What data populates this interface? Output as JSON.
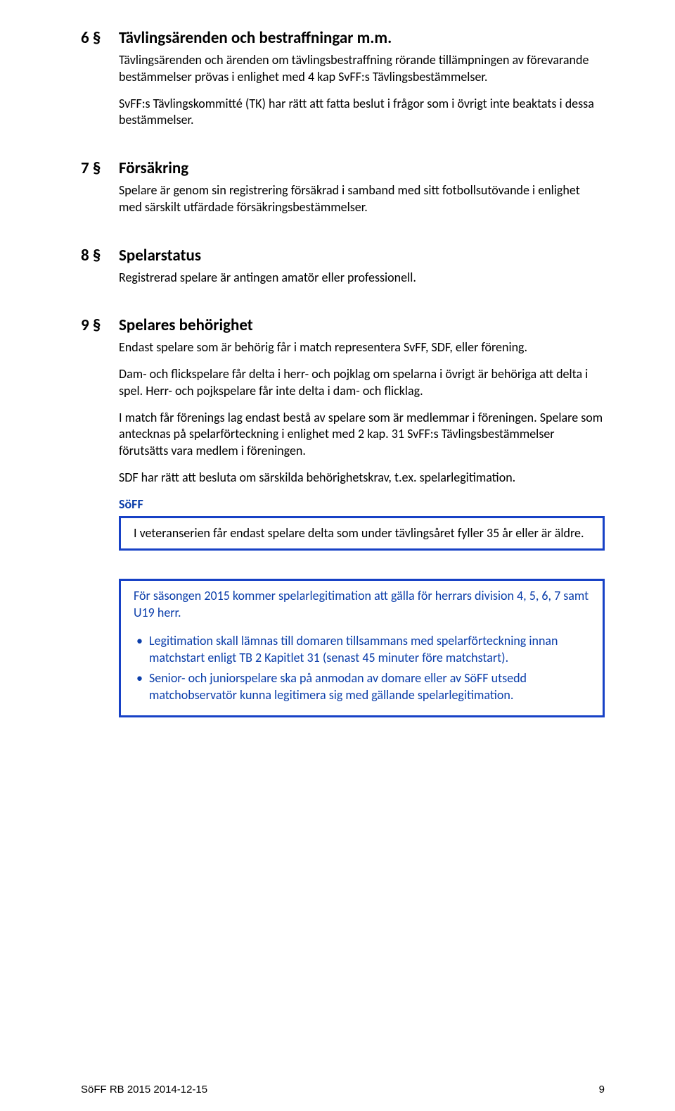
{
  "sections": {
    "s6": {
      "num": "6 §",
      "title": "Tävlingsärenden och bestraffningar m.m.",
      "paras": [
        "Tävlingsärenden och ärenden om tävlingsbestraffning rörande tillämpningen av förevarande bestämmelser prövas i enlighet med 4 kap SvFF:s Tävlingsbestämmelser.",
        "SvFF:s Tävlingskommitté (TK) har rätt att fatta beslut i frågor som i övrigt inte beaktats i dessa bestämmelser."
      ]
    },
    "s7": {
      "num": "7 §",
      "title": "Försäkring",
      "paras": [
        "Spelare är genom sin registrering försäkrad i samband med sitt fotbollsutövande i enlighet med särskilt utfärdade försäkringsbestämmelser."
      ]
    },
    "s8": {
      "num": "8 §",
      "title": "Spelarstatus",
      "paras": [
        "Registrerad spelare är antingen amatör eller professionell."
      ]
    },
    "s9": {
      "num": "9 §",
      "title": "Spelares behörighet",
      "paras": [
        "Endast spelare som är behörig får i match representera SvFF, SDF, eller förening.",
        "Dam- och flickspelare får delta i herr- och pojklag om spelarna i övrigt är behöriga att delta i spel. Herr- och pojkspelare får inte delta i dam- och flicklag.",
        "I match får förenings lag endast bestå av spelare som är medlemmar i föreningen. Spelare som antecknas på spelarförteckning i enlighet med 2 kap. 31 SvFF:s Tävlingsbestämmelser förutsätts vara medlem i föreningen.",
        "SDF har rätt att besluta om särskilda behörighetskrav, t.ex. spelarlegitimation."
      ]
    }
  },
  "soff_label": "SöFF",
  "box1": {
    "text": "I veteranserien får endast spelare delta som under tävlingsåret fyller 35 år eller är äldre."
  },
  "box2": {
    "intro": "För säsongen 2015 kommer spelarlegitimation att gälla för herrars division 4, 5, 6, 7 samt U19 herr.",
    "bullets": [
      "Legitimation skall lämnas till domaren tillsammans med spelarförteckning innan matchstart enligt TB 2 Kapitlet 31 (senast 45 minuter före matchstart).",
      "Senior- och juniorspelare ska på anmodan av domare eller av SöFF utsedd matchobservatör kunna legitimera sig med gällande spelarlegitimation."
    ]
  },
  "footer": {
    "left": "SöFF RB 2015 2014-12-15",
    "right": "9"
  }
}
